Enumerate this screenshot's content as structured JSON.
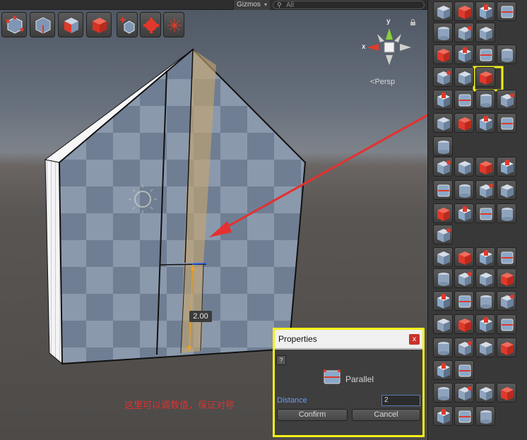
{
  "scene": {
    "gizmos_label": "Gizmos",
    "search_placeholder": "All",
    "persp_label": "Persp",
    "axis_y": "y",
    "axis_x": "x",
    "dimension_label": "2.00",
    "note_text": "这里可以调数值，保证对称"
  },
  "mini_toolbar": [
    {
      "name": "vertex-mode-icon"
    },
    {
      "name": "edge-mode-icon"
    },
    {
      "name": "face-mode-icon"
    },
    {
      "name": "object-mode-icon"
    },
    {
      "name": "add-object-icon"
    },
    {
      "name": "settings-gear-icon"
    },
    {
      "name": "pivot-icon"
    }
  ],
  "properties": {
    "title": "Properties",
    "close_label": "x",
    "help_label": "?",
    "tool_name": "Parallel",
    "distance_label": "Distance",
    "distance_value": "2",
    "confirm_label": "Confirm",
    "cancel_label": "Cancel"
  },
  "colors": {
    "highlight": "#f4f01a",
    "arrow": "#e53030",
    "tool_red": "#e0392b",
    "tool_blue": "#8aa8c8"
  },
  "tool_panel": {
    "buttons": [
      "cube-select-icon",
      "gem-icon",
      "stairs-block-icon",
      "grid-cube-icon",
      "cylinder-block-icon",
      "cube-icon",
      "prism-icon",
      "pen-tool-icon",
      "line-tool-icon",
      "curve-tool-icon",
      "plane-red-icon",
      "circle-red-icon",
      "triangle-red-icon",
      "parallel-tool-icon",
      "cube-small-icon",
      "cube-dark-icon",
      "cube-blue-icon",
      "staircase-icon",
      "cylinder-icon",
      "cone-icon",
      "dome-icon",
      "sphere-icon",
      "capsule-icon",
      "push-cube-icon",
      "extrude-up-icon",
      "extrude-stack-icon",
      "extrude-step-icon",
      "flip-cube-icon",
      "bevel-cube-icon",
      "split-cube-icon",
      "arrow-cube-icon",
      "bend-icon",
      "round-cube-icon",
      "edge-cube-icon",
      "dot-grid-icon",
      "hollow-cube-icon",
      "eraser-icon",
      "knife-icon",
      "target-icon",
      "copy-icon",
      "mirror-icon",
      "weld-icon",
      "slope-icon",
      "drop-icon",
      "refresh-icon",
      "snap-icon",
      "cylinder-cut-icon",
      "flip-edge-icon",
      "align-icon",
      "axis-icon",
      "plane-axis-icon",
      "corner-icon",
      "dice-icon",
      "red-dice-icon",
      "w-cube-icon",
      "pin-cube-icon",
      "slice-cube-icon",
      "tube-icon",
      "frame-icon",
      "move-cube-icon",
      "rotate-cube-icon",
      "rotate-frame-icon",
      "transform-cube-icon",
      "page-icon",
      "gear-red-icon"
    ]
  }
}
